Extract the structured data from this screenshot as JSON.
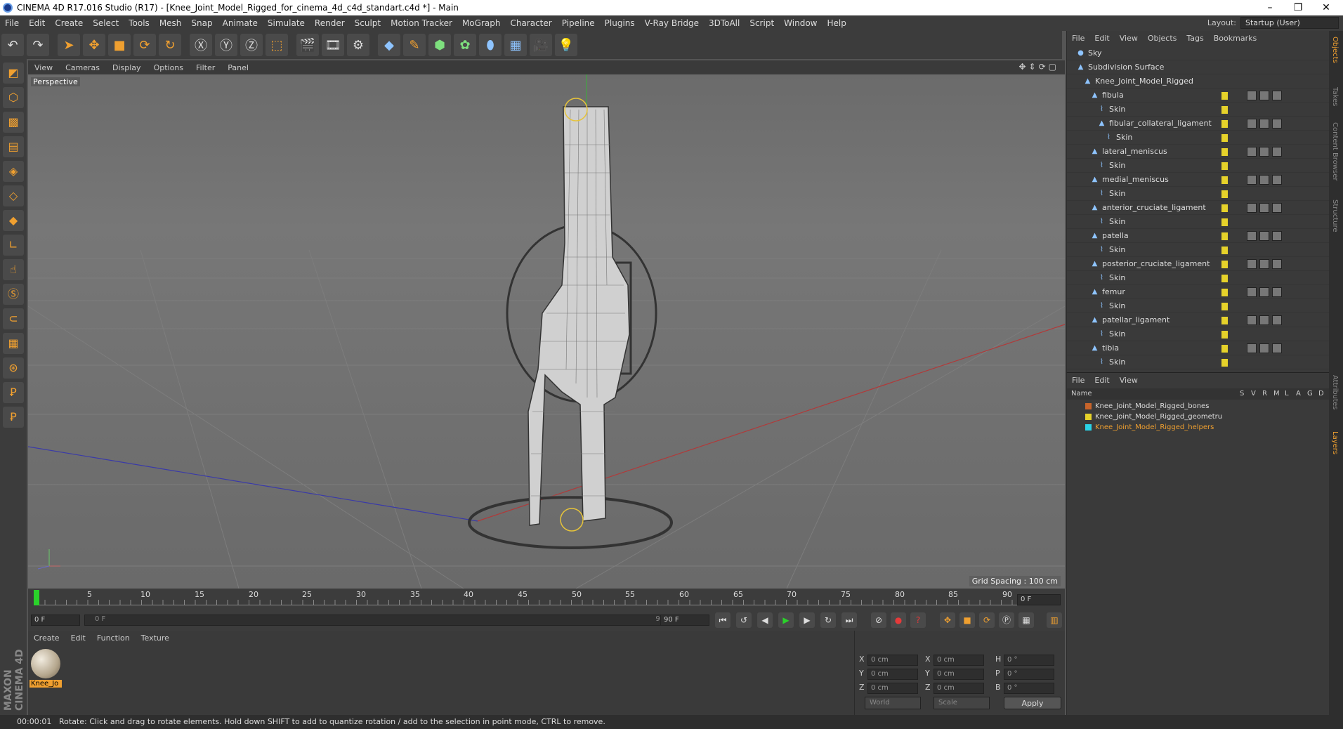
{
  "window": {
    "title": "CINEMA 4D R17.016 Studio (R17) - [Knee_Joint_Model_Rigged_for_cinema_4d_c4d_standart.c4d *] - Main"
  },
  "menubar": {
    "items": [
      "File",
      "Edit",
      "Create",
      "Select",
      "Tools",
      "Mesh",
      "Snap",
      "Animate",
      "Simulate",
      "Render",
      "Sculpt",
      "Motion Tracker",
      "MoGraph",
      "Character",
      "Pipeline",
      "Plugins",
      "V-Ray Bridge",
      "3DToAll",
      "Script",
      "Window",
      "Help"
    ],
    "layout_label": "Layout:",
    "layout_value": "Startup (User)"
  },
  "viewport": {
    "menu": [
      "View",
      "Cameras",
      "Display",
      "Options",
      "Filter",
      "Panel"
    ],
    "label": "Perspective",
    "grid_spacing": "Grid Spacing : 100 cm"
  },
  "timeline": {
    "ticks": [
      "0",
      "5",
      "10",
      "15",
      "20",
      "25",
      "30",
      "35",
      "40",
      "45",
      "50",
      "55",
      "60",
      "65",
      "70",
      "75",
      "80",
      "85",
      "90"
    ],
    "current_frame": "0 F",
    "start_field": "0 F",
    "range_start": "0 F",
    "range_end": "90 F",
    "end_field": "90 F"
  },
  "material_manager": {
    "menu": [
      "Create",
      "Edit",
      "Function",
      "Texture"
    ],
    "material_name": "Knee_Jo"
  },
  "attributes": {
    "rows": [
      {
        "a": "X",
        "av": "0 cm",
        "b": "X",
        "bv": "0 cm",
        "c": "H",
        "cv": "0 °"
      },
      {
        "a": "Y",
        "av": "0 cm",
        "b": "Y",
        "bv": "0 cm",
        "c": "P",
        "cv": "0 °"
      },
      {
        "a": "Z",
        "av": "0 cm",
        "b": "Z",
        "bv": "0 cm",
        "c": "B",
        "cv": "0 °"
      }
    ],
    "coord_mode": "World",
    "scale_mode": "Scale",
    "apply_label": "Apply"
  },
  "object_manager": {
    "menu": [
      "File",
      "Edit",
      "View",
      "Objects",
      "Tags",
      "Bookmarks"
    ],
    "objects": [
      {
        "name": "Sky",
        "depth": 0,
        "tags": false
      },
      {
        "name": "Subdivision Surface",
        "depth": 0,
        "tags": false
      },
      {
        "name": "Knee_Joint_Model_Rigged",
        "depth": 1,
        "tags": false
      },
      {
        "name": "fibula",
        "depth": 2,
        "tags": true
      },
      {
        "name": "Skin",
        "depth": 3,
        "tags": false
      },
      {
        "name": "fibular_collateral_ligament",
        "depth": 3,
        "tags": true
      },
      {
        "name": "Skin",
        "depth": 4,
        "tags": false
      },
      {
        "name": "lateral_meniscus",
        "depth": 2,
        "tags": true
      },
      {
        "name": "Skin",
        "depth": 3,
        "tags": false
      },
      {
        "name": "medial_meniscus",
        "depth": 2,
        "tags": true
      },
      {
        "name": "Skin",
        "depth": 3,
        "tags": false
      },
      {
        "name": "anterior_cruciate_ligament",
        "depth": 2,
        "tags": true
      },
      {
        "name": "Skin",
        "depth": 3,
        "tags": false
      },
      {
        "name": "patella",
        "depth": 2,
        "tags": true
      },
      {
        "name": "Skin",
        "depth": 3,
        "tags": false
      },
      {
        "name": "posterior_cruciate_ligament",
        "depth": 2,
        "tags": true
      },
      {
        "name": "Skin",
        "depth": 3,
        "tags": false
      },
      {
        "name": "femur",
        "depth": 2,
        "tags": true
      },
      {
        "name": "Skin",
        "depth": 3,
        "tags": false
      },
      {
        "name": "patellar_ligament",
        "depth": 2,
        "tags": true
      },
      {
        "name": "Skin",
        "depth": 3,
        "tags": false
      },
      {
        "name": "tibia",
        "depth": 2,
        "tags": true
      },
      {
        "name": "Skin",
        "depth": 3,
        "tags": false
      }
    ]
  },
  "layer_manager": {
    "menu": [
      "File",
      "Edit",
      "View"
    ],
    "header_name": "Name",
    "header_cols": [
      "S",
      "V",
      "R",
      "M",
      "L",
      "A",
      "G",
      "D"
    ],
    "layers": [
      {
        "name": "Knee_Joint_Model_Rigged_bones",
        "color": "#c8642a"
      },
      {
        "name": "Knee_Joint_Model_Rigged_geometru",
        "color": "#e6d22a"
      },
      {
        "name": "Knee_Joint_Model_Rigged_helpers",
        "color": "#2ad2e6"
      }
    ]
  },
  "side_tabs": [
    "Objects",
    "Takes",
    "Content Browser",
    "Structure",
    "Attributes",
    "Layers"
  ],
  "status": {
    "time": "00:00:01",
    "message": "Rotate: Click and drag to rotate elements. Hold down SHIFT to add to quantize rotation / add to the selection in point mode, CTRL to remove."
  },
  "brand": {
    "maxon": "MAXON CINEMA 4D",
    "accent": "#f0a030"
  }
}
